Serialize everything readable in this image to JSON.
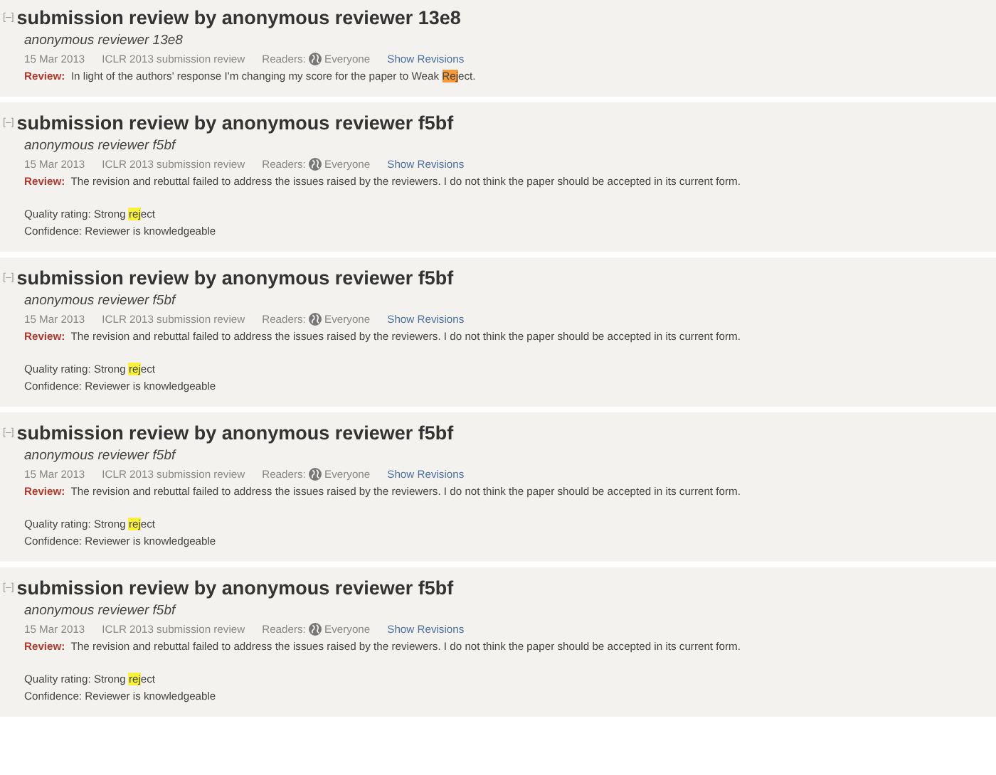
{
  "reviews": [
    {
      "toggle": "[–]",
      "title": "submission review by anonymous reviewer 13e8",
      "author": "anonymous reviewer 13e8",
      "date": "15 Mar 2013",
      "invitation": "ICLR 2013 submission review",
      "readers_label": "Readers:",
      "readers": "Everyone",
      "revisions_link": "Show Revisions",
      "review_label": "Review:",
      "review_segments": [
        {
          "text": "In light of the authors' response I'm changing my score for the paper to Weak "
        },
        {
          "text": "Rej",
          "color": "#f59a3c"
        },
        {
          "text": "ect."
        }
      ]
    },
    {
      "toggle": "[–]",
      "title": "submission review by anonymous reviewer f5bf",
      "author": "anonymous reviewer f5bf",
      "date": "15 Mar 2013",
      "invitation": "ICLR 2013 submission review",
      "readers_label": "Readers:",
      "readers": "Everyone",
      "revisions_link": "Show Revisions",
      "review_label": "Review:",
      "review_segments": [
        {
          "text": "The revision and rebuttal failed to address the issues raised by the reviewers. I do not think the paper should be accepted in its current form."
        }
      ],
      "quality_segments": [
        {
          "text": "Quality rating: Strong "
        },
        {
          "text": "rej",
          "color": "#f7f03c"
        },
        {
          "text": "ect"
        }
      ],
      "confidence": "Confidence: Reviewer is knowledgeable"
    },
    {
      "toggle": "[–]",
      "title": "submission review by anonymous reviewer f5bf",
      "author": "anonymous reviewer f5bf",
      "date": "15 Mar 2013",
      "invitation": "ICLR 2013 submission review",
      "readers_label": "Readers:",
      "readers": "Everyone",
      "revisions_link": "Show Revisions",
      "review_label": "Review:",
      "review_segments": [
        {
          "text": "The revision and rebuttal failed to address the issues raised by the reviewers. I do not think the paper should be accepted in its current form."
        }
      ],
      "quality_segments": [
        {
          "text": "Quality rating: Strong "
        },
        {
          "text": "rej",
          "color": "#f7f03c"
        },
        {
          "text": "ect"
        }
      ],
      "confidence": "Confidence: Reviewer is knowledgeable"
    },
    {
      "toggle": "[–]",
      "title": "submission review by anonymous reviewer f5bf",
      "author": "anonymous reviewer f5bf",
      "date": "15 Mar 2013",
      "invitation": "ICLR 2013 submission review",
      "readers_label": "Readers:",
      "readers": "Everyone",
      "revisions_link": "Show Revisions",
      "review_label": "Review:",
      "review_segments": [
        {
          "text": "The revision and rebuttal failed to address the issues raised by the reviewers. I do not think the paper should be accepted in its current form."
        }
      ],
      "quality_segments": [
        {
          "text": "Quality rating: Strong "
        },
        {
          "text": "rej",
          "color": "#f7f03c"
        },
        {
          "text": "ect"
        }
      ],
      "confidence": "Confidence: Reviewer is knowledgeable"
    },
    {
      "toggle": "[–]",
      "title": "submission review by anonymous reviewer f5bf",
      "author": "anonymous reviewer f5bf",
      "date": "15 Mar 2013",
      "invitation": "ICLR 2013 submission review",
      "readers_label": "Readers:",
      "readers": "Everyone",
      "revisions_link": "Show Revisions",
      "review_label": "Review:",
      "review_segments": [
        {
          "text": "The revision and rebuttal failed to address the issues raised by the reviewers. I do not think the paper should be accepted in its current form."
        }
      ],
      "quality_segments": [
        {
          "text": "Quality rating: Strong "
        },
        {
          "text": "rej",
          "color": "#f7f03c"
        },
        {
          "text": "ect"
        }
      ],
      "confidence": "Confidence: Reviewer is knowledgeable"
    }
  ]
}
